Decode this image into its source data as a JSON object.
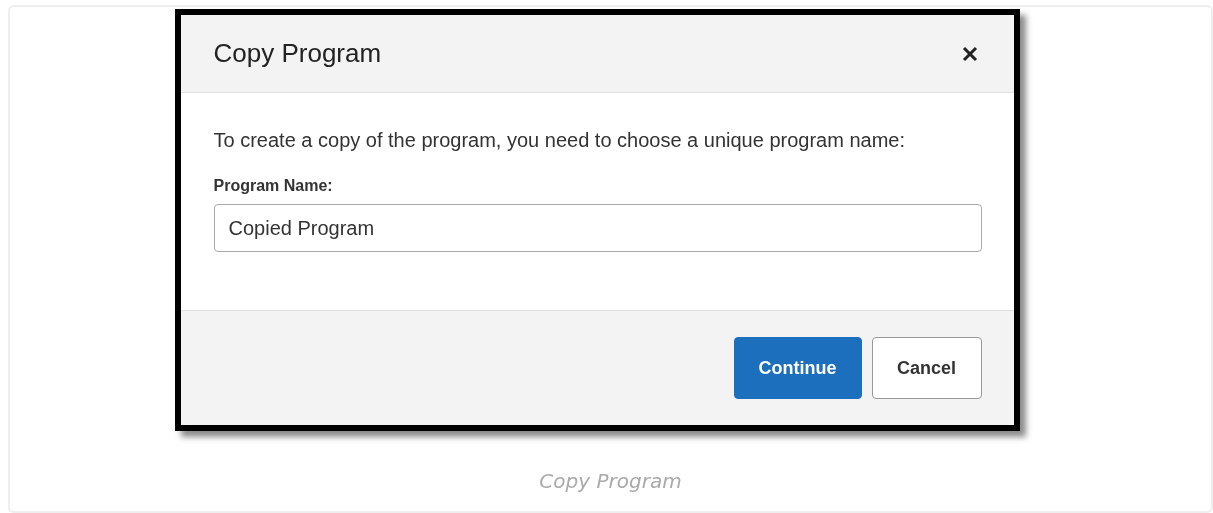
{
  "dialog": {
    "title": "Copy Program",
    "message": "To create a copy of the program, you need to choose a unique program name:",
    "field": {
      "label": "Program Name:",
      "value": "Copied Program"
    },
    "buttons": [
      {
        "label": "Continue",
        "kind": "primary"
      },
      {
        "label": "Cancel",
        "kind": "secondary"
      }
    ]
  },
  "caption": "Copy Program"
}
